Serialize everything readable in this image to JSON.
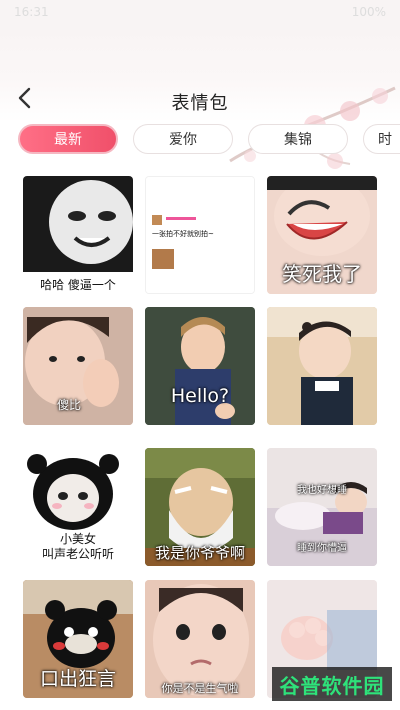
{
  "status": {
    "time": "16:31",
    "right": "100%"
  },
  "header": {
    "title": "表情包"
  },
  "tabs": [
    {
      "label": "最新",
      "active": true
    },
    {
      "label": "爱你",
      "active": false
    },
    {
      "label": "集锦",
      "active": false
    },
    {
      "label": "时",
      "active": false
    }
  ],
  "grid": [
    {
      "caption": "哈哈 傻逼一个"
    },
    {
      "caption": "一张拍不好就别拍~"
    },
    {
      "caption": "笑死我了"
    },
    {
      "caption": "傻比"
    },
    {
      "caption": "Hello?"
    },
    {
      "caption": ""
    },
    {
      "caption": "小美女\n叫声老公听听"
    },
    {
      "caption": "我是你爷爷啊"
    },
    {
      "caption": "我也好想睡\n睡到你懵逼"
    },
    {
      "caption": "口出狂言"
    },
    {
      "caption": "你是不是生气啦"
    },
    {
      "caption": ""
    }
  ],
  "watermark": {
    "text": "谷普软件园"
  },
  "colors": {
    "accent": "#f0506a",
    "tab_border": "#e8e0e0"
  }
}
